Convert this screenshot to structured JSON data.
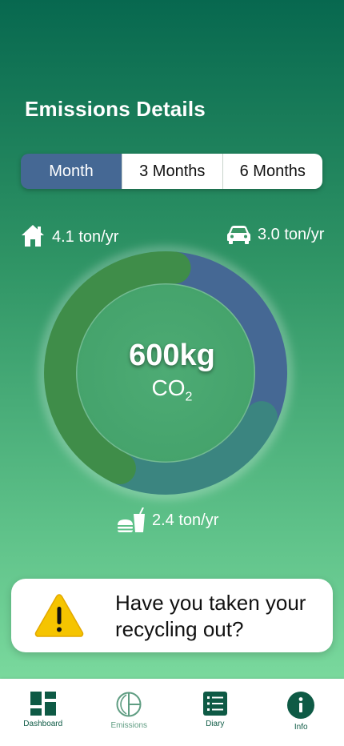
{
  "header": {
    "title": "Emissions Details"
  },
  "periods": [
    {
      "label": "Month",
      "active": true
    },
    {
      "label": "3 Months",
      "active": false
    },
    {
      "label": "6 Months",
      "active": false
    }
  ],
  "stats": {
    "home": {
      "icon": "house-icon",
      "value": "4.1 ton/yr"
    },
    "car": {
      "icon": "car-icon",
      "value": "3.0 ton/yr"
    },
    "food": {
      "icon": "food-drink-icon",
      "value": "2.4 ton/yr"
    }
  },
  "donut": {
    "center_value": "600kg",
    "center_unit": "CO",
    "center_unit_sub": "2",
    "colors": {
      "home": "#3f8d49",
      "car": "#456894",
      "food": "#3b8580"
    }
  },
  "tip": {
    "icon": "warning-icon",
    "text": "Have you taken your recycling out?"
  },
  "nav": [
    {
      "label": "Dashboard",
      "icon": "dashboard-icon"
    },
    {
      "label": "Emissions",
      "icon": "emissions-icon"
    },
    {
      "label": "Diary",
      "icon": "diary-icon"
    },
    {
      "label": "Info",
      "icon": "info-icon"
    }
  ]
}
